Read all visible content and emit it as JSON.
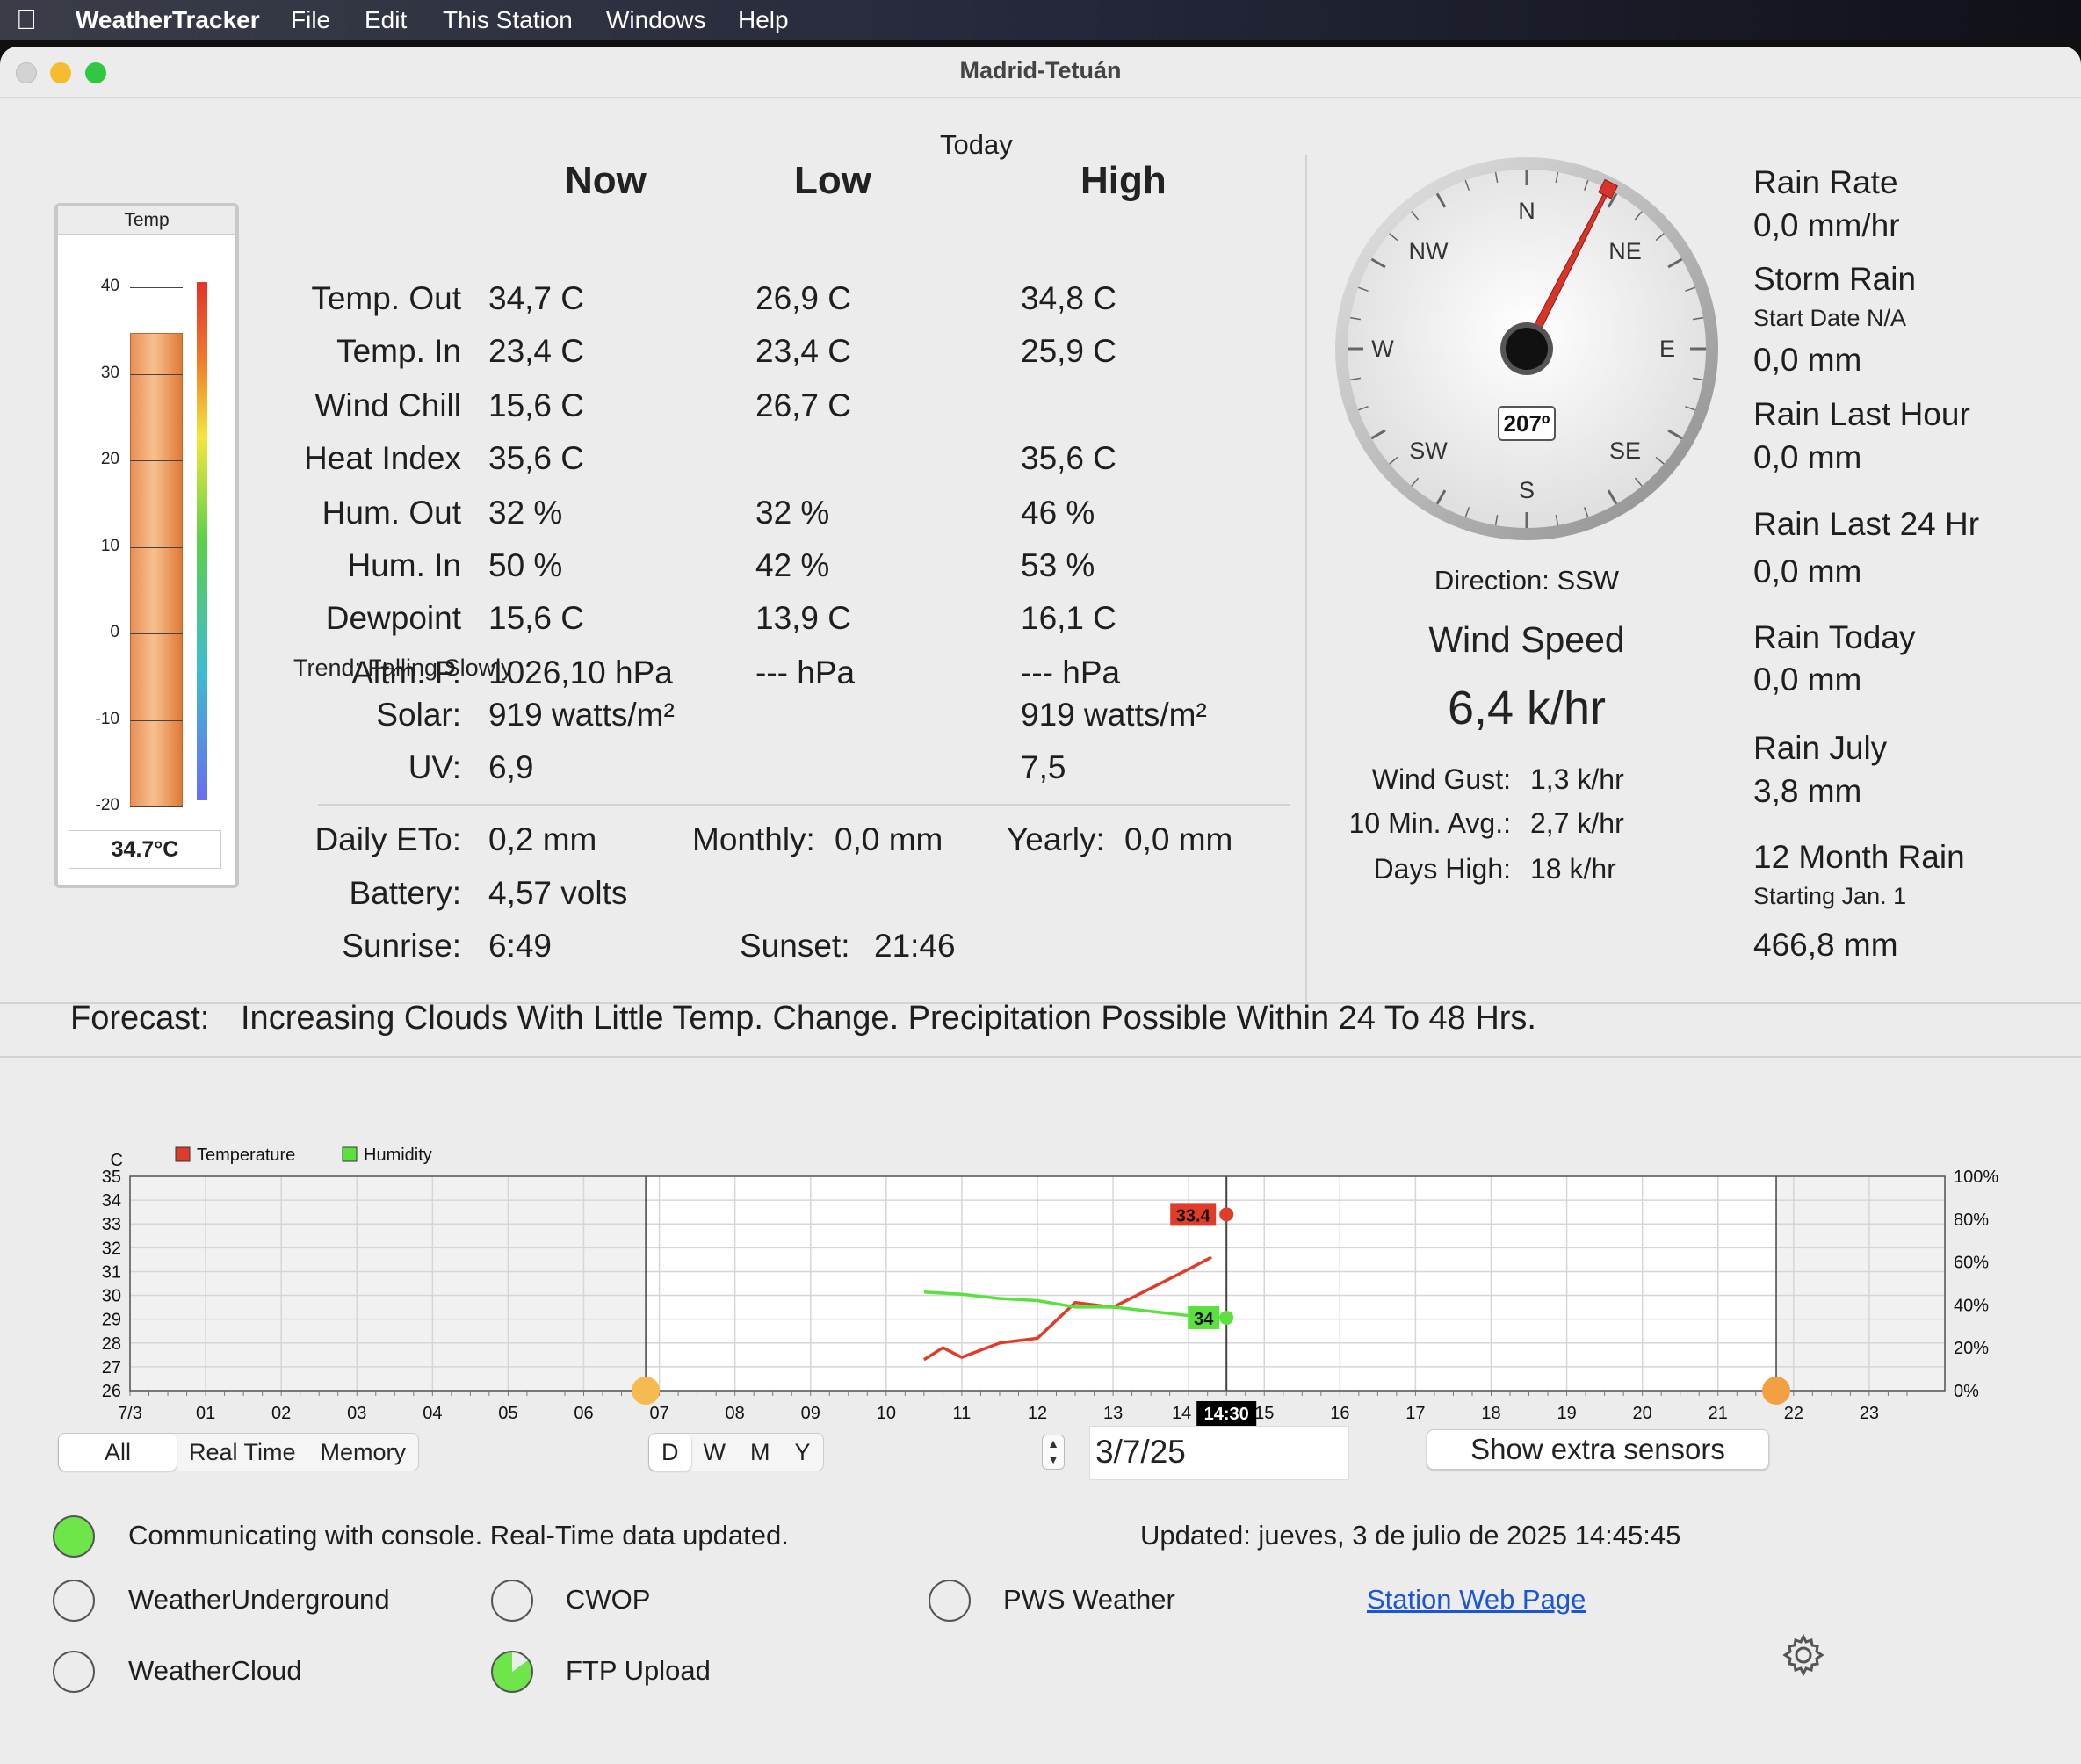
{
  "menubar": {
    "app": "WeatherTracker",
    "items": [
      "File",
      "Edit",
      "This Station",
      "Windows",
      "Help"
    ]
  },
  "window": {
    "title": "Madrid-Tetuán"
  },
  "thermometer": {
    "label": "Temp",
    "reading": "34.7°C",
    "scale": [
      "40",
      "30",
      "20",
      "10",
      "0",
      "-10",
      "-20"
    ],
    "level_c": 34.7
  },
  "table": {
    "today": "Today",
    "headers": {
      "now": "Now",
      "low": "Low",
      "high": "High"
    },
    "rows": [
      {
        "label": "Temp. Out",
        "now": "34,7 C",
        "low": "26,9 C",
        "high": "34,8 C"
      },
      {
        "label": "Temp. In",
        "now": "23,4 C",
        "low": "23,4 C",
        "high": "25,9 C"
      },
      {
        "label": "Wind Chill",
        "now": "15,6 C",
        "low": "26,7 C",
        "high": ""
      },
      {
        "label": "Heat Index",
        "now": "35,6 C",
        "low": "",
        "high": "35,6 C"
      },
      {
        "label": "Hum. Out",
        "now": "32 %",
        "low": "32 %",
        "high": "46 %"
      },
      {
        "label": "Hum. In",
        "now": "50 %",
        "low": "42 %",
        "high": "53 %"
      },
      {
        "label": "Dewpoint",
        "now": "15,6 C",
        "low": "13,9 C",
        "high": "16,1 C"
      },
      {
        "label": "Altm. P.",
        "now": "1026,10 hPa",
        "low": "--- hPa",
        "high": "--- hPa"
      }
    ],
    "trend": "Trend: Falling Slowly",
    "solar": {
      "label": "Solar:",
      "now": "919 watts/m²",
      "high": "919 watts/m²"
    },
    "uv": {
      "label": "UV:",
      "now": "6,9",
      "high": "7,5"
    },
    "eto": {
      "label": "Daily ETo:",
      "value": "0,2 mm",
      "monthly_label": "Monthly:",
      "monthly": "0,0 mm",
      "yearly_label": "Yearly:",
      "yearly": "0,0 mm"
    },
    "battery": {
      "label": "Battery:",
      "value": "4,57 volts"
    },
    "sunrise": {
      "label": "Sunrise:",
      "value": "6:49"
    },
    "sunset": {
      "label": "Sunset:",
      "value": "21:46"
    }
  },
  "wind": {
    "compass": {
      "N": "N",
      "NE": "NE",
      "E": "E",
      "SE": "SE",
      "S": "S",
      "SW": "SW",
      "W": "W",
      "NW": "NW"
    },
    "degrees": "207º",
    "direction_deg": 207,
    "direction": "Direction: SSW",
    "speed_label": "Wind Speed",
    "speed": "6,4 k/hr",
    "gust_label": "Wind Gust:",
    "gust": "1,3 k/hr",
    "avg_label": "10 Min. Avg.:",
    "avg": "2,7 k/hr",
    "dayhigh_label": "Days High:",
    "dayhigh": "18 k/hr"
  },
  "rain": {
    "rate_label": "Rain Rate",
    "rate": "0,0 mm/hr",
    "storm_label": "Storm Rain",
    "storm_note": "Start Date N/A",
    "storm": "0,0 mm",
    "hour_label": "Rain Last Hour",
    "hour": "0,0 mm",
    "day24_label": "Rain Last 24 Hr",
    "day24": "0,0 mm",
    "today_label": "Rain Today",
    "today": "0,0 mm",
    "month_label": "Rain July",
    "month": "3,8 mm",
    "year_label": "12 Month Rain",
    "year_note": "Starting Jan. 1",
    "year": "466,8 mm"
  },
  "forecast": {
    "label": "Forecast:",
    "text": "Increasing Clouds With Little Temp. Change. Precipitation Possible Within 24 To 48 Hrs."
  },
  "chart_data": {
    "type": "line",
    "ylabel": "C",
    "ylim": [
      26,
      35
    ],
    "y2lim": [
      0,
      100
    ],
    "yticks": [
      "35",
      "34",
      "33",
      "32",
      "31",
      "30",
      "29",
      "28",
      "27",
      "26"
    ],
    "y2ticks": [
      "100%",
      "80%",
      "60%",
      "40%",
      "20%",
      "0%"
    ],
    "xticks": [
      "7/3",
      "01",
      "02",
      "03",
      "04",
      "05",
      "06",
      "07",
      "08",
      "09",
      "10",
      "11",
      "12",
      "13",
      "14",
      "15",
      "16",
      "17",
      "18",
      "19",
      "20",
      "21",
      "22",
      "23"
    ],
    "xlim": [
      0,
      24
    ],
    "cursor_label": "14:30",
    "cursor_hour": 14.5,
    "sunrise_hour": 6.82,
    "sunset_hour": 21.77,
    "series": [
      {
        "name": "Temperature",
        "axis": "left",
        "color": "#e03c2a",
        "x": [
          10.5,
          10.75,
          11.0,
          11.5,
          12.0,
          12.5,
          13.0,
          13.5,
          14.0,
          14.3
        ],
        "y": [
          27.3,
          27.8,
          27.4,
          28.0,
          28.2,
          29.7,
          29.5,
          30.3,
          31.1,
          31.6
        ]
      },
      {
        "name": "Humidity",
        "axis": "right",
        "color": "#5ce040",
        "x": [
          10.5,
          11.0,
          11.5,
          12.0,
          12.5,
          13.0,
          13.5,
          14.0,
          14.5
        ],
        "y": [
          46,
          45,
          43,
          42,
          39,
          39,
          37,
          35,
          34
        ]
      }
    ],
    "labels": {
      "temp_value": "33.4",
      "hum_value": "34",
      "temp_marker": 33.4,
      "hum_marker": 34
    }
  },
  "controls": {
    "source": [
      "All",
      "Real Time",
      "Memory"
    ],
    "period": [
      "D",
      "W",
      "M",
      "Y"
    ],
    "date": "3/7/25",
    "extra_button": "Show extra sensors"
  },
  "status": {
    "comm": "Communicating with console. Real-Time data updated.",
    "updated": "Updated: jueves, 3 de julio de 2025 14:45:45",
    "wu": "WeatherUnderground",
    "cwop": "CWOP",
    "pws": "PWS Weather",
    "link": "Station Web Page",
    "wc": "WeatherCloud",
    "ftp": "FTP Upload"
  },
  "colors": {
    "temp": "#e03c2a",
    "hum": "#5ce040",
    "ok": "#6ee64a",
    "link": "#1a56d6"
  }
}
